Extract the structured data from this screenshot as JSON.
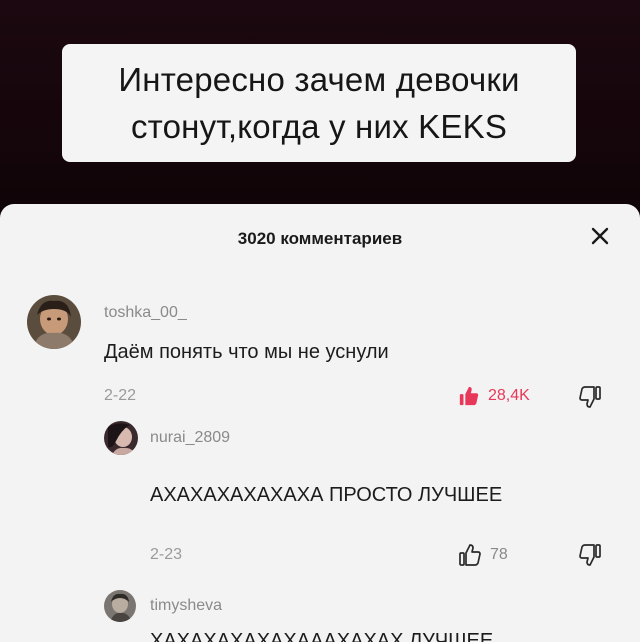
{
  "caption": {
    "line1": "Интересно зачем девочки",
    "line2": "стонут,когда у них KEKS"
  },
  "sheet": {
    "comment_count": "3020 комментариев",
    "close_icon": "close-icon"
  },
  "comments": [
    {
      "username": "toshka_00_",
      "text": "Даём понять что мы не уснули",
      "date": "2-22",
      "likes": "28,4K",
      "liked": true,
      "like_color": "#e8385a"
    },
    {
      "username": "nurai_2809",
      "text": "АХАХАХАХАХАХА ПРОСТО ЛУЧШЕЕ",
      "date": "2-23",
      "likes": "78",
      "liked": false
    },
    {
      "username": "timysheva",
      "text": "ХАХАХАХАХАХАААХАХАХ ЛУЧШЕЕ"
    }
  ]
}
